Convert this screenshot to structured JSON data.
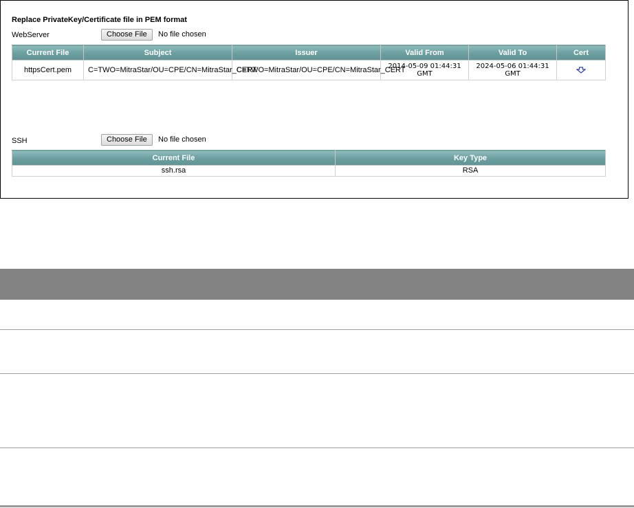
{
  "heading": "Replace PrivateKey/Certificate file in PEM format",
  "webserver": {
    "label": "WebServer",
    "button_label": "Choose File",
    "file_status": "No file chosen",
    "columns": [
      "Current File",
      "Subject",
      "Issuer",
      "Valid From",
      "Valid To",
      "Cert"
    ],
    "row": {
      "current_file": "httpsCert.pem",
      "subject": "C=TWO=MitraStar/OU=CPE/CN=MitraStar_CERT",
      "issuer": "C=TWO=MitraStar/OU=CPE/CN=MitraStar_CERT",
      "valid_from": "2014-05-09 01:44:31 GMT",
      "valid_to": "2024-05-06 01:44:31 GMT",
      "cert_icon": "download-icon"
    }
  },
  "ssh": {
    "label": "SSH",
    "button_label": "Choose File",
    "file_status": "No file chosen",
    "columns": [
      "Current File",
      "Key Type"
    ],
    "row": {
      "current_file": "ssh.rsa",
      "key_type": "RSA"
    }
  },
  "colors": {
    "header_teal": "#6a9e9f",
    "gray_bar": "#838383",
    "icon_blue": "#2b3fbf"
  }
}
